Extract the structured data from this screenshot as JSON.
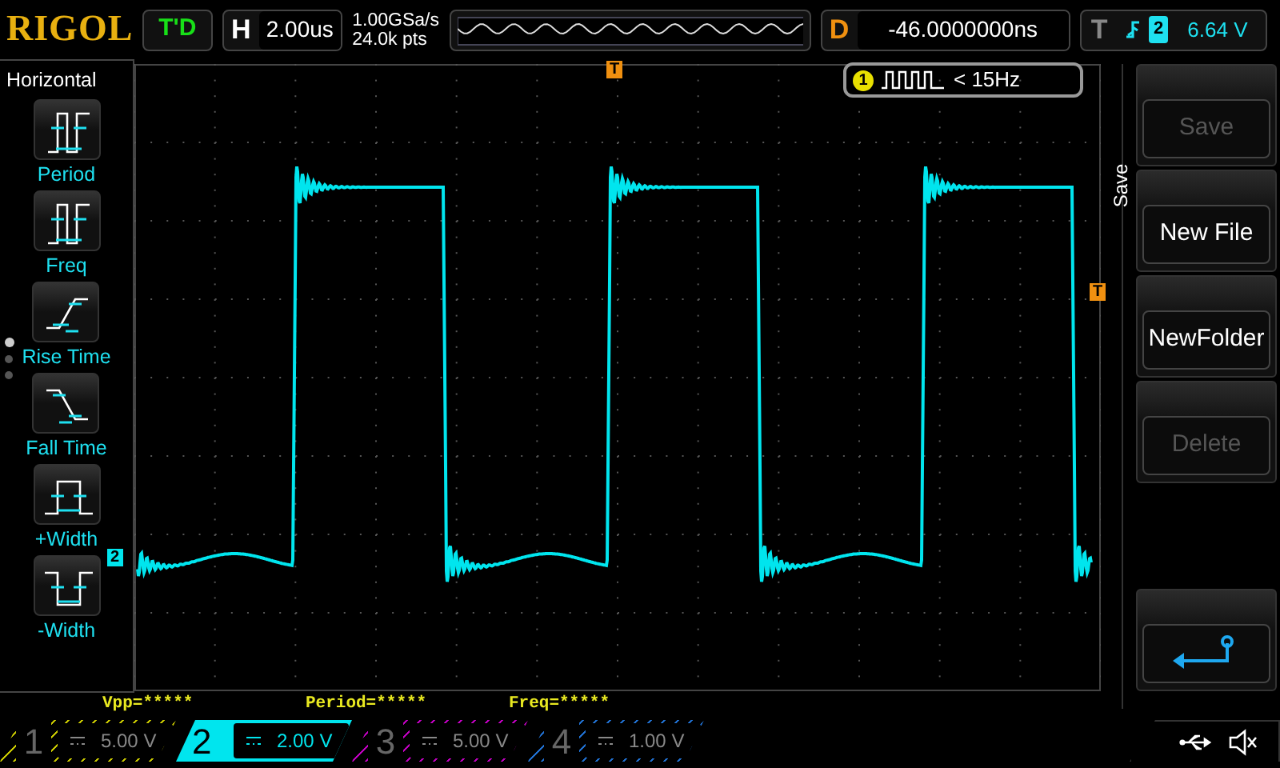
{
  "header": {
    "logo": "RIGOL",
    "trigger_status": "T'D",
    "timebase": {
      "label": "H",
      "value": "2.00us"
    },
    "sample_rate": "1.00GSa/s",
    "memory_depth": "24.0k pts",
    "delay": {
      "label": "D",
      "value": "-46.0000000ns"
    },
    "trigger": {
      "label": "T",
      "source": "2",
      "level": "6.64 V"
    }
  },
  "measure_menu": {
    "title": "Horizontal",
    "items": [
      {
        "label": "Period",
        "kind": "period"
      },
      {
        "label": "Freq",
        "kind": "freq"
      },
      {
        "label": "Rise Time",
        "kind": "rise"
      },
      {
        "label": "Fall Time",
        "kind": "fall"
      },
      {
        "label": "+Width",
        "kind": "pwidth"
      },
      {
        "label": "-Width",
        "kind": "nwidth"
      }
    ],
    "pages": [
      {
        "selected": true
      },
      {
        "selected": false
      },
      {
        "selected": false
      }
    ]
  },
  "display": {
    "trigger_position_marker": "T",
    "trigger_level_marker": "T",
    "channel_marker": "2",
    "counter": {
      "channel": "1",
      "reading": "< 15Hz"
    }
  },
  "softkeys": {
    "menu_title": "Save",
    "keys": [
      {
        "kind": "text",
        "label": "Save",
        "disabled": true
      },
      {
        "kind": "text",
        "label": "New File",
        "disabled": false
      },
      {
        "kind": "text",
        "label": "NewFolder",
        "disabled": false
      },
      {
        "kind": "text",
        "label": "Delete",
        "disabled": true
      },
      {
        "kind": "back"
      }
    ]
  },
  "measurements": [
    "Vpp=*****",
    "Period=*****",
    "Freq=*****"
  ],
  "channels": [
    {
      "number": "1",
      "scale": "5.00 V",
      "selected": false,
      "color": "#c8c800"
    },
    {
      "number": "2",
      "scale": "2.00 V",
      "selected": true,
      "color": "#00e5ee"
    },
    {
      "number": "3",
      "scale": "5.00 V",
      "selected": false,
      "color": "#c000c0"
    },
    {
      "number": "4",
      "scale": "1.00 V",
      "selected": false,
      "color": "#2070d0"
    }
  ]
}
